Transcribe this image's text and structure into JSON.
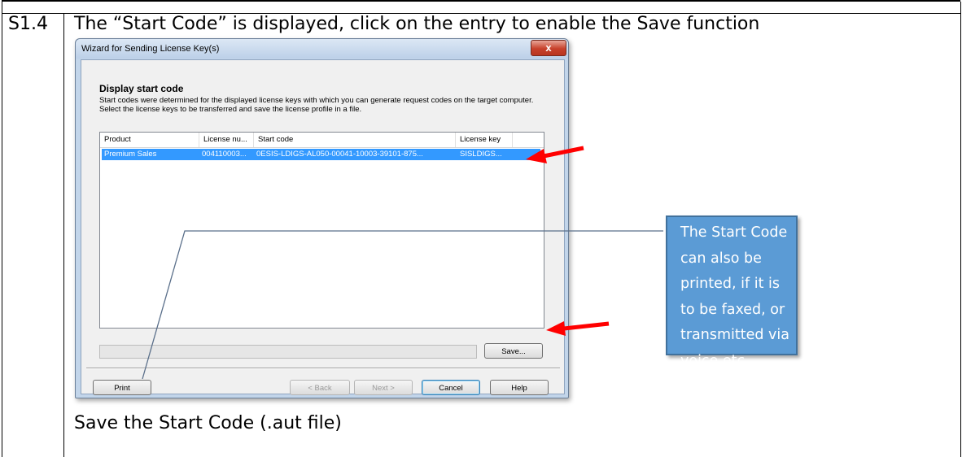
{
  "document": {
    "step_id": "S1.4",
    "instruction": "The “Start Code” is displayed, click on the entry to enable the Save function",
    "footer_note": "Save the Start Code (.aut file)"
  },
  "dialog": {
    "title": "Wizard for Sending License Key(s)",
    "close_label": "x",
    "heading": "Display start code",
    "description": "Start codes were determined for the displayed license keys with which you can generate request codes on the target computer.\nSelect the license keys to be transferred and save the license profile in a file.",
    "columns": [
      "Product",
      "License nu...",
      "Start code",
      "License key"
    ],
    "rows": [
      {
        "product": "Premium Sales",
        "license_number": "004110003...",
        "start_code": "0ESIS-LDIGS-AL050-00041-10003-39101-875...",
        "license_key": "SISLDIGS..."
      }
    ],
    "buttons": {
      "save": "Save...",
      "print": "Print",
      "back": "< Back",
      "next": "Next >",
      "cancel": "Cancel",
      "help": "Help"
    }
  },
  "callout": {
    "text": "The Start Code can also be printed, if it is to be faxed, or transmitted via voice etc."
  },
  "colors": {
    "arrow": "#ff0000",
    "callout_fill": "#5b9bd5",
    "selection": "#3399ff"
  }
}
